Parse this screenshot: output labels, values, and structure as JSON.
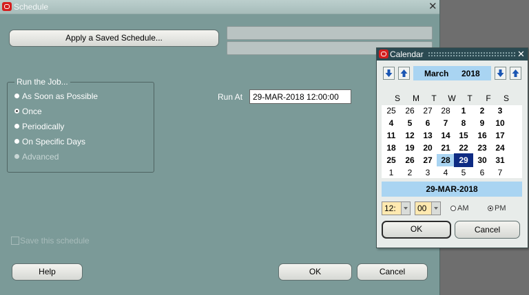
{
  "schedule": {
    "title": "Schedule",
    "apply_saved": "Apply a Saved Schedule...",
    "run_group": "Run the Job...",
    "options": [
      "As Soon as Possible",
      "Once",
      "Periodically",
      "On Specific Days",
      "Advanced"
    ],
    "selected_option": "Once",
    "run_at_label": "Run At",
    "run_at_value": "29-MAR-2018 12:00:00",
    "save_label": "Save this schedule",
    "help": "Help",
    "ok": "OK",
    "cancel": "Cancel"
  },
  "calendar": {
    "title": "Calendar",
    "month": "March",
    "year": "2018",
    "weekdays": [
      "S",
      "M",
      "T",
      "W",
      "T",
      "F",
      "S"
    ],
    "weeks": [
      [
        "25",
        "26",
        "27",
        "28",
        "1",
        "2",
        "3"
      ],
      [
        "4",
        "5",
        "6",
        "7",
        "8",
        "9",
        "10"
      ],
      [
        "11",
        "12",
        "13",
        "14",
        "15",
        "16",
        "17"
      ],
      [
        "18",
        "19",
        "20",
        "21",
        "22",
        "23",
        "24"
      ],
      [
        "25",
        "26",
        "27",
        "28",
        "29",
        "30",
        "31"
      ],
      [
        "1",
        "2",
        "3",
        "4",
        "5",
        "6",
        "7"
      ]
    ],
    "selected_date": "29-MAR-2018",
    "hour": "12:",
    "minute": "00",
    "am": "AM",
    "pm": "PM",
    "ok": "OK",
    "cancel": "Cancel"
  },
  "colors": {
    "window_bg": "#7b9a98",
    "calendar_title_bg": "#2b4a52",
    "highlight": "#a9d4f2",
    "selected_day": "#0e2b83"
  },
  "icons": [
    "oracle-logo-icon",
    "close-icon",
    "arrow-down-icon",
    "arrow-up-icon",
    "dropdown-arrow-icon"
  ]
}
